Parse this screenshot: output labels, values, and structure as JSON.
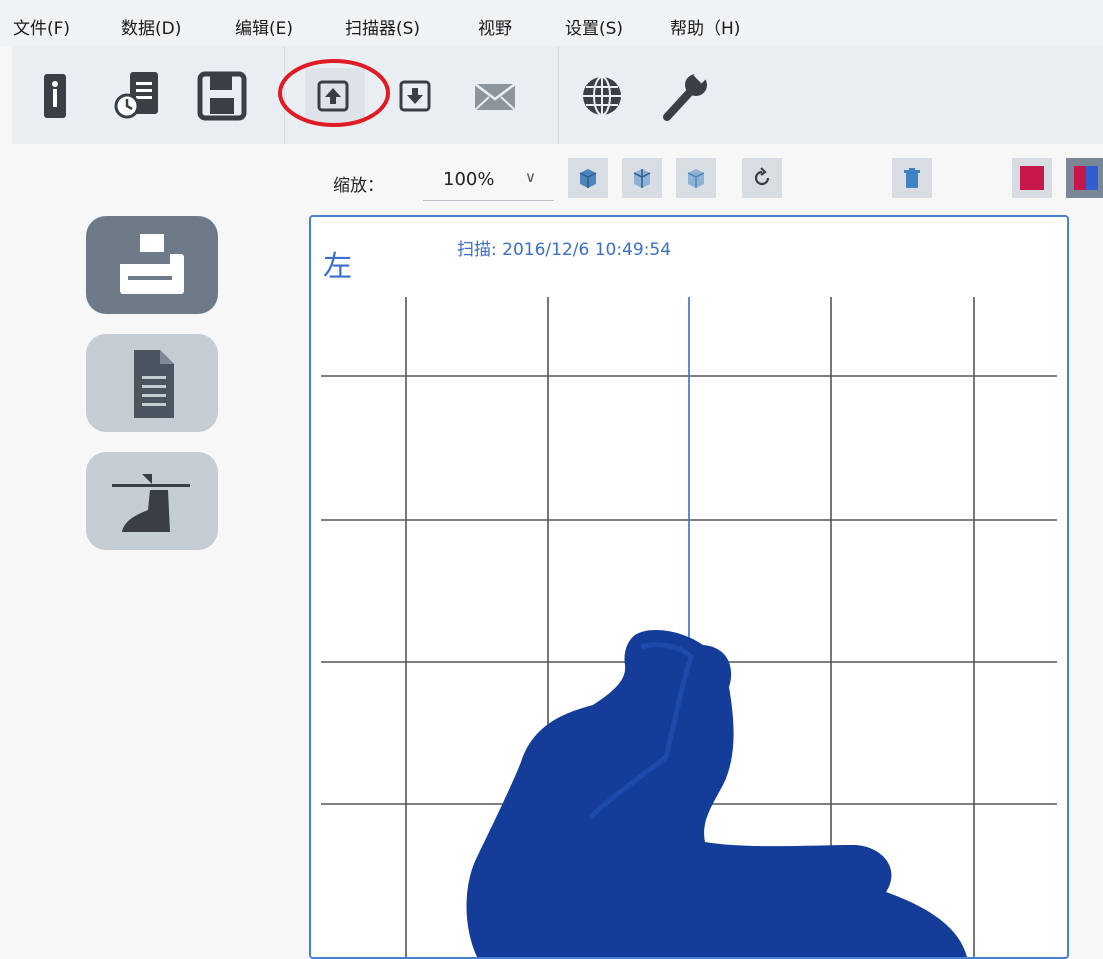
{
  "menu": {
    "file": "文件(F)",
    "data": "数据(D)",
    "edit": "编辑(E)",
    "scanner": "扫描器(S)",
    "view": "视野",
    "settings": "设置(S)",
    "help": "帮助（H)"
  },
  "toolbar": {
    "icons": [
      "new-patient-icon",
      "history-document-icon",
      "save-icon",
      "upload-icon",
      "download-icon",
      "mail-icon",
      "globe-icon",
      "wrench-icon"
    ],
    "highlighted": "upload-button",
    "highlight_color": "#e01b24"
  },
  "zoom": {
    "label": "缩放：",
    "value": "100%"
  },
  "viewport": {
    "side_label": "左",
    "scan_text": "扫描:  2016/12/6 10:49:54",
    "accent_color": "#3b6fc9",
    "model_color": "#143d9a"
  },
  "sidebar": {
    "items": [
      "scanner-icon",
      "document-icon",
      "foot-measure-icon"
    ],
    "active": "scanner"
  }
}
